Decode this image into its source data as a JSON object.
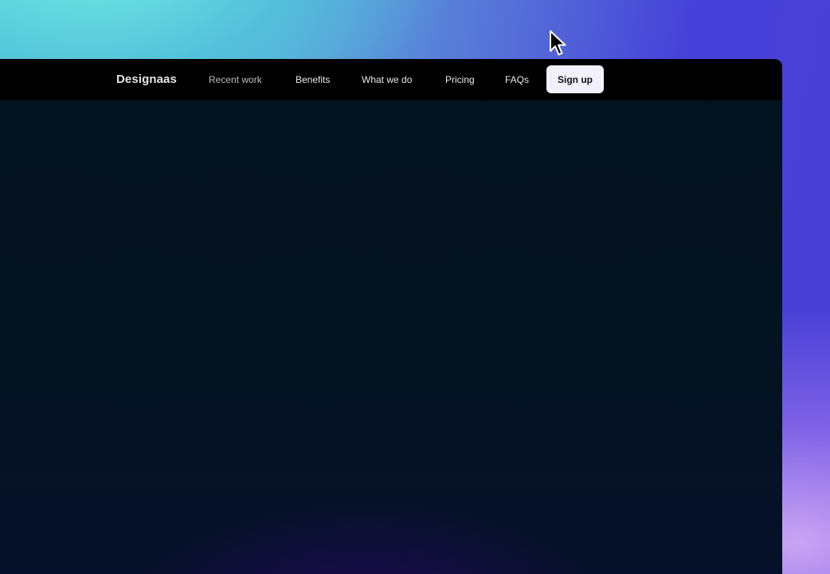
{
  "navbar": {
    "brand": "Designaas",
    "links": [
      {
        "label": "Recent work"
      },
      {
        "label": "Benefits"
      },
      {
        "label": "What we do"
      },
      {
        "label": "Pricing"
      },
      {
        "label": "FAQs"
      }
    ],
    "signup_label": "Sign up"
  },
  "colors": {
    "navbar_bg": "#000000",
    "page_bg": "#03121f",
    "signup_bg": "#f1f0fb",
    "backdrop_accent": "#4a3fd6"
  },
  "cursor": {
    "icon": "arrow-cursor-icon"
  }
}
